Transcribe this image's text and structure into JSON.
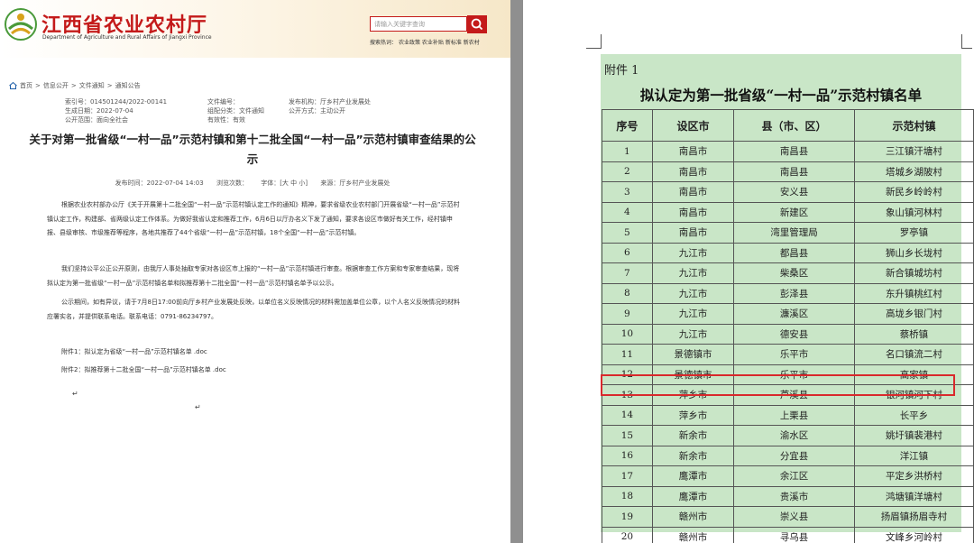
{
  "header": {
    "site_title": "江西省农业农村厅",
    "site_subtitle": "Department of Agriculture and Rural Affairs of Jiangxi Province",
    "search_placeholder": "请输入关键字查询",
    "hot_search_label": "搜索热词：",
    "hot_search_terms": [
      "农业政策",
      "农业补贴",
      "新标准",
      "新农村"
    ]
  },
  "breadcrumb": [
    "首页",
    "信息公开",
    "文件通知",
    "通知公告"
  ],
  "meta": {
    "index_no": "索引号：014501244/2022-00141",
    "doc_no": "文件编号：",
    "publisher": "发布机构：厅乡村产业发展处",
    "gen_date": "生成日期：2022-07-04",
    "category": "组配分类：文件通知",
    "open_mode": "公开方式：主动公开",
    "scope": "公开范围：面向全社会",
    "validity": "有效性：有效"
  },
  "article": {
    "title": "关于对第一批省级“一村一品”示范村镇和第十二批全国“一村一品”示范村镇审查结果的公示",
    "pub_time": "发布时间：2022-07-04 14:03",
    "views": "浏览次数：",
    "font_size": "字体：[大 中 小]",
    "source": "来源：厅乡村产业发展处",
    "paragraphs": [
      "根据农业农村部办公厅《关于开展第十二批全国“一村一品”示范村镇认定工作的通知》精神，要求省级农业农村部门开展省级“一村一品”示范村镇认定工作，构建部、省两级认定工作体系。为做好我省认定和推荐工作，6月6日以厅办名义下发了通知，要求各设区市做好有关工作，经村镇申报、县级审核、市级推荐等程序，各地共推荐了44个省级“一村一品”示范村镇，18个全国“一村一品”示范村镇。",
      "我们坚持公平公正公开原则，由我厅人事处抽取专家对各设区市上报的“一村一品”示范村镇进行审查。根据审查工作方案和专家审查结果，现将拟认定为第一批省级“一村一品”示范村镇名单和拟推荐第十二批全国“一村一品”示范村镇名单予以公示。",
      "公示期间，如有异议，请于7月8日17:00前向厅乡村产业发展处反映，以单位名义反映情况的材料需加盖单位公章，以个人名义反映情况的材料应署实名，并提供联系电话。联系电话：0791-86234797。"
    ],
    "attachments": [
      "附件1：拟认定为省级“一村一品”示范村镇名单 .doc",
      "附件2：拟推荐第十二批全国“一村一品”示范村镇名单 .doc"
    ]
  },
  "document": {
    "attachment_label": "附件 1",
    "table_title": "拟认定为第一批省级“一村一品”示范村镇名单",
    "columns": [
      "序号",
      "设区市",
      "县（市、区）",
      "示范村镇"
    ],
    "rows": [
      [
        "1",
        "南昌市",
        "南昌县",
        "三江镇汗塘村"
      ],
      [
        "2",
        "南昌市",
        "南昌县",
        "塔城乡湖陂村"
      ],
      [
        "3",
        "南昌市",
        "安义县",
        "新民乡岭岭村"
      ],
      [
        "4",
        "南昌市",
        "新建区",
        "象山镇河林村"
      ],
      [
        "5",
        "南昌市",
        "湾里管理局",
        "罗亭镇"
      ],
      [
        "6",
        "九江市",
        "都昌县",
        "狮山乡长垅村"
      ],
      [
        "7",
        "九江市",
        "柴桑区",
        "新合镇城坊村"
      ],
      [
        "8",
        "九江市",
        "彭泽县",
        "东升镇桃红村"
      ],
      [
        "9",
        "九江市",
        "濂溪区",
        "高垅乡银门村"
      ],
      [
        "10",
        "九江市",
        "德安县",
        "蔡桥镇"
      ],
      [
        "11",
        "景德镇市",
        "乐平市",
        "名口镇流二村"
      ],
      [
        "12",
        "景德镇市",
        "乐平市",
        "高家镇"
      ],
      [
        "13",
        "萍乡市",
        "芦溪县",
        "银河镇河下村"
      ],
      [
        "14",
        "萍乡市",
        "上栗县",
        "长平乡"
      ],
      [
        "15",
        "新余市",
        "渝水区",
        "姚圩镇裴港村"
      ],
      [
        "16",
        "新余市",
        "分宜县",
        "洋江镇"
      ],
      [
        "17",
        "鹰潭市",
        "余江区",
        "平定乡洪桥村"
      ],
      [
        "18",
        "鹰潭市",
        "贵溪市",
        "鸿塘镇洋塘村"
      ],
      [
        "19",
        "赣州市",
        "崇义县",
        "扬眉镇扬眉寺村"
      ],
      [
        "20",
        "赣州市",
        "寻乌县",
        "文峰乡河岭村"
      ]
    ]
  }
}
